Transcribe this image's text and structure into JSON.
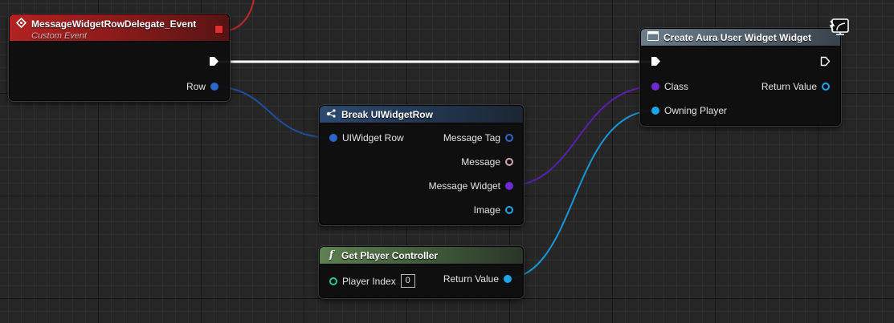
{
  "colors": {
    "exec": "#ffffff",
    "struct": "#2a67c9",
    "object_magenta": "#d7a7b6",
    "class_purple": "#6e2ad1",
    "object_blue": "#1fa4e6",
    "player_index": "#2ec4a0",
    "event_header": "#b32222",
    "break_header": "#2c4a70",
    "function_header": "#5e8050",
    "create_header": "#6b7c8b"
  },
  "event_node": {
    "title": "MessageWidgetRowDelegate_Event",
    "subtitle": "Custom Event",
    "title_icon": "event-diamond-icon",
    "output_pin_row": "Row"
  },
  "break_node": {
    "title": "Break UIWidgetRow",
    "title_icon": "break-struct-icon",
    "input_pin": "UIWidget Row",
    "outputs": [
      "Message Tag",
      "Message",
      "Message Widget",
      "Image"
    ]
  },
  "player_node": {
    "title": "Get Player Controller",
    "title_icon": "function-f-icon",
    "input_label": "Player Index",
    "input_value": "0",
    "output_label": "Return Value"
  },
  "create_node": {
    "title": "Create Aura User Widget Widget",
    "title_icon": "widget-icon",
    "corner_icon": "network-monitor-icon",
    "input_class": "Class",
    "input_owner": "Owning Player",
    "output_return": "Return Value"
  }
}
